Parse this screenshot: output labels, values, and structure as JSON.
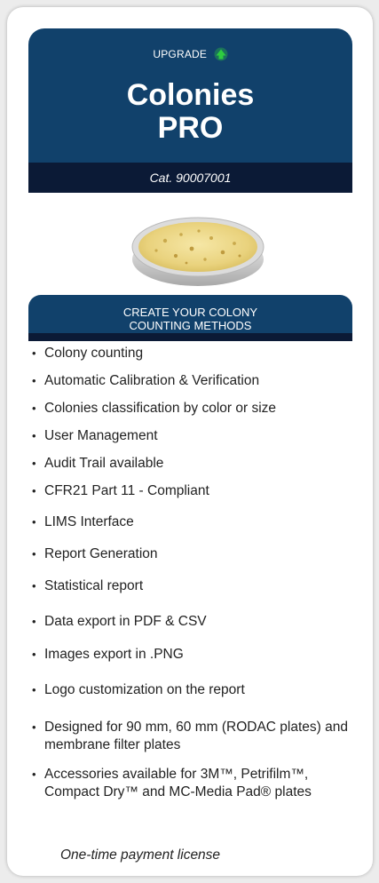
{
  "header": {
    "upgrade_label": "UPGRADE",
    "upgrade_icon": "green-arrow-up-icon",
    "title_line1": "Colonies",
    "title_line2": "PRO",
    "catalog": "Cat. 90007001"
  },
  "image": {
    "icon": "petri-dish-with-colonies"
  },
  "section": {
    "heading_line1": "CREATE YOUR COLONY",
    "heading_line2": "COUNTING METHODS"
  },
  "features": [
    "Colony counting",
    "Automatic Calibration & Verification",
    "Colonies classification by color or size",
    "User Management",
    "Audit Trail available",
    "CFR21 Part 11 - Compliant",
    "LIMS Interface",
    "Report Generation",
    "Statistical report",
    "Data export in PDF & CSV",
    "Images export in .PNG",
    "Logo customization on the report",
    "Designed for 90 mm, 60 mm (RODAC plates) and membrane filter plates",
    "Accessories available for 3M™, Petrifilm™, Compact Dry™ and MC-Media Pad® plates"
  ],
  "bullet_char": "•",
  "footer": {
    "license_note": "One-time payment license"
  },
  "colors": {
    "header_blue": "#11416b",
    "dark_navy": "#0b1a36",
    "upgrade_green": "#2ecc40"
  }
}
